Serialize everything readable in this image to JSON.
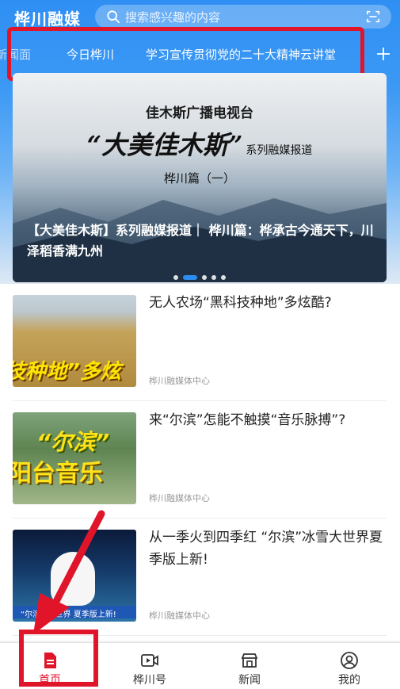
{
  "header": {
    "app_title": "桦川融媒",
    "search_placeholder": "搜索感兴趣的内容",
    "search_icon": "search-icon",
    "scan_icon": "scan-icon"
  },
  "tabs": [
    "新闻面",
    "今日桦川",
    "学习宣传贯彻党的二十大精神云讲堂"
  ],
  "add_tab_icon": "plus-icon",
  "banner": {
    "station": "佳木斯广播电视台",
    "slogan": "“大美佳木斯”",
    "slogan_sub": "系列融媒报道",
    "episode": "桦川篇（一）",
    "caption": "【大美佳木斯】系列融媒报道｜ 桦川篇：桦承古今通天下，川泽稻香满九州",
    "active_dot": 1,
    "dot_count": 5
  },
  "articles": [
    {
      "title": "无人农场“黑科技种地”多炫酷?",
      "source": "桦川融媒体中心",
      "thumb_text": "技种地”多炫"
    },
    {
      "title": "来“尔滨”怎能不触摸“音乐脉搏”?",
      "source": "桦川融媒体中心",
      "thumb_text_1": "“尔滨”",
      "thumb_text_2": "阳台音乐"
    },
    {
      "title": "从一季火到四季红 “尔滨”冰雪大世界夏季版上新!",
      "source": "桦川融媒体中心",
      "thumb_text": "“尔滨” 大世界 夏季版上新!"
    }
  ],
  "bottom_nav": [
    {
      "label": "首页",
      "icon": "home-doc-icon",
      "active": true
    },
    {
      "label": "桦川号",
      "icon": "video-icon",
      "active": false
    },
    {
      "label": "新闻",
      "icon": "store-icon",
      "active": false
    },
    {
      "label": "我的",
      "icon": "profile-icon",
      "active": false
    }
  ],
  "colors": {
    "accent_blue": "#2f8ff3",
    "highlight_red": "#e0152a",
    "active_nav": "#e0152a"
  }
}
